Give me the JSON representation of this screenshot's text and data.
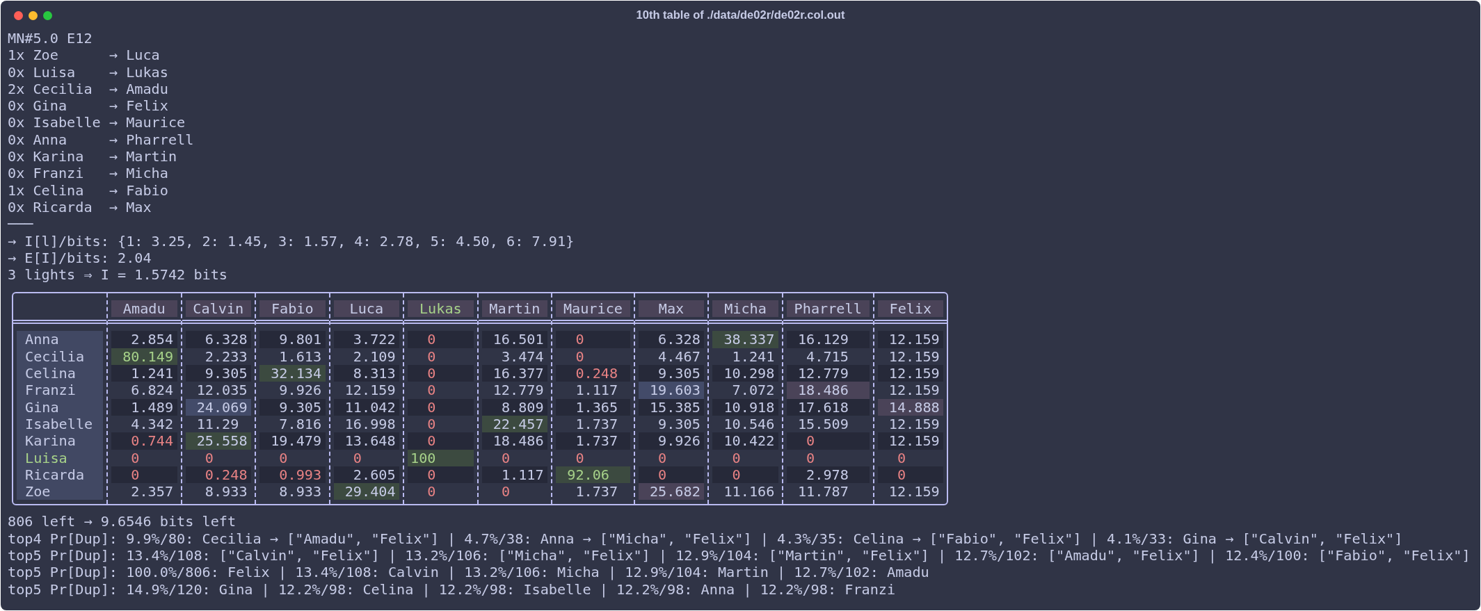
{
  "window": {
    "title": "10th table of ./data/de02r/de02r.col.out"
  },
  "header_lines": [
    "MN#5.0 E12",
    "1x Zoe      → Luca",
    "0x Luisa    → Lukas",
    "2x Cecilia  → Amadu",
    "0x Gina     → Felix",
    "0x Isabelle → Maurice",
    "0x Anna     → Pharrell",
    "0x Karina   → Martin",
    "0x Franzi   → Micha",
    "1x Celina   → Fabio",
    "0x Ricarda  → Max",
    "───",
    "→ I[l]/bits: {1: 3.25, 2: 1.45, 3: 1.57, 4: 2.78, 5: 4.50, 6: 7.91}",
    "→ E[I]/bits: 2.04",
    "3 lights ⇒ I = 1.5742 bits"
  ],
  "table": {
    "columns": [
      {
        "label": "Amadu",
        "confirmed": false
      },
      {
        "label": "Calvin",
        "confirmed": false
      },
      {
        "label": "Fabio",
        "confirmed": false
      },
      {
        "label": "Luca",
        "confirmed": false
      },
      {
        "label": "Lukas",
        "confirmed": true
      },
      {
        "label": "Martin",
        "confirmed": false
      },
      {
        "label": "Maurice",
        "confirmed": false
      },
      {
        "label": "Max",
        "confirmed": false
      },
      {
        "label": "Micha",
        "confirmed": false
      },
      {
        "label": "Pharrell",
        "confirmed": false
      },
      {
        "label": "Felix",
        "confirmed": false
      }
    ],
    "rows": [
      {
        "name": "Anna",
        "confirmed": false,
        "cells": [
          {
            "value": "2.854",
            "low": false,
            "strong": false
          },
          {
            "value": "6.328",
            "low": false,
            "strong": false
          },
          {
            "value": "9.801",
            "low": false,
            "strong": false
          },
          {
            "value": "3.722",
            "low": false,
            "strong": false
          },
          {
            "value": "0",
            "low": true,
            "strong": false
          },
          {
            "value": "16.501",
            "low": false,
            "strong": false
          },
          {
            "value": "0",
            "low": true,
            "strong": false
          },
          {
            "value": "6.328",
            "low": false,
            "strong": false
          },
          {
            "value": "38.337",
            "low": false,
            "strong": false,
            "color": "#3c4a40"
          },
          {
            "value": "16.129",
            "low": false,
            "strong": false
          },
          {
            "value": "12.159",
            "low": false,
            "strong": false
          }
        ]
      },
      {
        "name": "Cecilia",
        "confirmed": false,
        "cells": [
          {
            "value": "80.149",
            "low": false,
            "strong": true,
            "color": "#3c4a40"
          },
          {
            "value": "2.233",
            "low": false,
            "strong": false
          },
          {
            "value": "1.613",
            "low": false,
            "strong": false
          },
          {
            "value": "2.109",
            "low": false,
            "strong": false
          },
          {
            "value": "0",
            "low": true,
            "strong": false
          },
          {
            "value": "3.474",
            "low": false,
            "strong": false
          },
          {
            "value": "0",
            "low": true,
            "strong": false
          },
          {
            "value": "4.467",
            "low": false,
            "strong": false
          },
          {
            "value": "1.241",
            "low": false,
            "strong": false
          },
          {
            "value": "4.715",
            "low": false,
            "strong": false
          },
          {
            "value": "12.159",
            "low": false,
            "strong": false
          }
        ]
      },
      {
        "name": "Celina",
        "confirmed": false,
        "cells": [
          {
            "value": "1.241",
            "low": false,
            "strong": false
          },
          {
            "value": "9.305",
            "low": false,
            "strong": false
          },
          {
            "value": "32.134",
            "low": false,
            "strong": false,
            "color": "#3c4a40"
          },
          {
            "value": "8.313",
            "low": false,
            "strong": false
          },
          {
            "value": "0",
            "low": true,
            "strong": false
          },
          {
            "value": "16.377",
            "low": false,
            "strong": false
          },
          {
            "value": "0.248",
            "low": true,
            "strong": false
          },
          {
            "value": "9.305",
            "low": false,
            "strong": false
          },
          {
            "value": "10.298",
            "low": false,
            "strong": false
          },
          {
            "value": "12.779",
            "low": false,
            "strong": false
          },
          {
            "value": "12.159",
            "low": false,
            "strong": false
          }
        ]
      },
      {
        "name": "Franzi",
        "confirmed": false,
        "cells": [
          {
            "value": "6.824",
            "low": false,
            "strong": false
          },
          {
            "value": "12.035",
            "low": false,
            "strong": false
          },
          {
            "value": "9.926",
            "low": false,
            "strong": false
          },
          {
            "value": "12.159",
            "low": false,
            "strong": false
          },
          {
            "value": "0",
            "low": true,
            "strong": false
          },
          {
            "value": "12.779",
            "low": false,
            "strong": false
          },
          {
            "value": "1.117",
            "low": false,
            "strong": false
          },
          {
            "value": "19.603",
            "low": false,
            "strong": false,
            "color": "#434b69"
          },
          {
            "value": "7.072",
            "low": false,
            "strong": false
          },
          {
            "value": "18.486",
            "low": false,
            "strong": false,
            "color": "#4a4358"
          },
          {
            "value": "12.159",
            "low": false,
            "strong": false
          }
        ]
      },
      {
        "name": "Gina",
        "confirmed": false,
        "cells": [
          {
            "value": "1.489",
            "low": false,
            "strong": false
          },
          {
            "value": "24.069",
            "low": false,
            "strong": false,
            "color": "#434b69"
          },
          {
            "value": "9.305",
            "low": false,
            "strong": false
          },
          {
            "value": "11.042",
            "low": false,
            "strong": false
          },
          {
            "value": "0",
            "low": true,
            "strong": false
          },
          {
            "value": "8.809",
            "low": false,
            "strong": false
          },
          {
            "value": "1.365",
            "low": false,
            "strong": false
          },
          {
            "value": "15.385",
            "low": false,
            "strong": false
          },
          {
            "value": "10.918",
            "low": false,
            "strong": false
          },
          {
            "value": "17.618",
            "low": false,
            "strong": false
          },
          {
            "value": "14.888",
            "low": false,
            "strong": false,
            "color": "#4a4358"
          }
        ]
      },
      {
        "name": "Isabelle",
        "confirmed": false,
        "cells": [
          {
            "value": "4.342",
            "low": false,
            "strong": false
          },
          {
            "value": "11.29",
            "low": false,
            "strong": false
          },
          {
            "value": "7.816",
            "low": false,
            "strong": false
          },
          {
            "value": "16.998",
            "low": false,
            "strong": false
          },
          {
            "value": "0",
            "low": true,
            "strong": false
          },
          {
            "value": "22.457",
            "low": false,
            "strong": false,
            "color": "#3c4a40"
          },
          {
            "value": "1.737",
            "low": false,
            "strong": false
          },
          {
            "value": "9.305",
            "low": false,
            "strong": false
          },
          {
            "value": "10.546",
            "low": false,
            "strong": false
          },
          {
            "value": "15.509",
            "low": false,
            "strong": false
          },
          {
            "value": "12.159",
            "low": false,
            "strong": false
          }
        ]
      },
      {
        "name": "Karina",
        "confirmed": false,
        "cells": [
          {
            "value": "0.744",
            "low": true,
            "strong": false
          },
          {
            "value": "25.558",
            "low": false,
            "strong": false,
            "color": "#3c4a40"
          },
          {
            "value": "19.479",
            "low": false,
            "strong": false
          },
          {
            "value": "13.648",
            "low": false,
            "strong": false
          },
          {
            "value": "0",
            "low": true,
            "strong": false
          },
          {
            "value": "18.486",
            "low": false,
            "strong": false
          },
          {
            "value": "1.737",
            "low": false,
            "strong": false
          },
          {
            "value": "9.926",
            "low": false,
            "strong": false
          },
          {
            "value": "10.422",
            "low": false,
            "strong": false
          },
          {
            "value": "0",
            "low": true,
            "strong": false
          },
          {
            "value": "12.159",
            "low": false,
            "strong": false
          }
        ]
      },
      {
        "name": "Luisa",
        "confirmed": true,
        "cells": [
          {
            "value": "0",
            "low": true,
            "strong": false
          },
          {
            "value": "0",
            "low": true,
            "strong": false
          },
          {
            "value": "0",
            "low": true,
            "strong": false
          },
          {
            "value": "0",
            "low": true,
            "strong": false
          },
          {
            "value": "100",
            "low": false,
            "strong": true,
            "color": "#3c4a40"
          },
          {
            "value": "0",
            "low": true,
            "strong": false
          },
          {
            "value": "0",
            "low": true,
            "strong": false
          },
          {
            "value": "0",
            "low": true,
            "strong": false
          },
          {
            "value": "0",
            "low": true,
            "strong": false
          },
          {
            "value": "0",
            "low": true,
            "strong": false
          },
          {
            "value": "0",
            "low": true,
            "strong": false
          }
        ]
      },
      {
        "name": "Ricarda",
        "confirmed": false,
        "cells": [
          {
            "value": "0",
            "low": true,
            "strong": false
          },
          {
            "value": "0.248",
            "low": true,
            "strong": false
          },
          {
            "value": "0.993",
            "low": true,
            "strong": false
          },
          {
            "value": "2.605",
            "low": false,
            "strong": false
          },
          {
            "value": "0",
            "low": true,
            "strong": false
          },
          {
            "value": "1.117",
            "low": false,
            "strong": false
          },
          {
            "value": "92.06",
            "low": false,
            "strong": true,
            "color": "#3c4a40"
          },
          {
            "value": "0",
            "low": true,
            "strong": false
          },
          {
            "value": "0",
            "low": true,
            "strong": false
          },
          {
            "value": "2.978",
            "low": false,
            "strong": false
          },
          {
            "value": "0",
            "low": true,
            "strong": false
          }
        ]
      },
      {
        "name": "Zoe",
        "confirmed": false,
        "cells": [
          {
            "value": "2.357",
            "low": false,
            "strong": false
          },
          {
            "value": "8.933",
            "low": false,
            "strong": false
          },
          {
            "value": "8.933",
            "low": false,
            "strong": false
          },
          {
            "value": "29.404",
            "low": false,
            "strong": false,
            "color": "#3c4a40"
          },
          {
            "value": "0",
            "low": true,
            "strong": false
          },
          {
            "value": "0",
            "low": true,
            "strong": false
          },
          {
            "value": "1.737",
            "low": false,
            "strong": false
          },
          {
            "value": "25.682",
            "low": false,
            "strong": false,
            "color": "#4a4358"
          },
          {
            "value": "11.166",
            "low": false,
            "strong": false
          },
          {
            "value": "11.787",
            "low": false,
            "strong": false
          },
          {
            "value": "12.159",
            "low": false,
            "strong": false
          }
        ]
      }
    ]
  },
  "footer_lines": [
    "806 left → 9.6546 bits left",
    "top4 Pr[Dup]: 9.9%/80: Cecilia → [\"Amadu\", \"Felix\"] | 4.7%/38: Anna → [\"Micha\", \"Felix\"] | 4.3%/35: Celina → [\"Fabio\", \"Felix\"] | 4.1%/33: Gina → [\"Calvin\", \"Felix\"]",
    "top5 Pr[Dup]: 13.4%/108: [\"Calvin\", \"Felix\"] | 13.2%/106: [\"Micha\", \"Felix\"] | 12.9%/104: [\"Martin\", \"Felix\"] | 12.7%/102: [\"Amadu\", \"Felix\"] | 12.4%/100: [\"Fabio\", \"Felix\"]",
    "top5 Pr[Dup]: 100.0%/806: Felix | 13.4%/108: Calvin | 13.2%/106: Micha | 12.9%/104: Martin | 12.7%/102: Amadu",
    "top5 Pr[Dup]: 14.9%/120: Gina | 12.2%/98: Celina | 12.2%/98: Isabelle | 12.2%/98: Anna | 12.2%/98: Franzi"
  ]
}
